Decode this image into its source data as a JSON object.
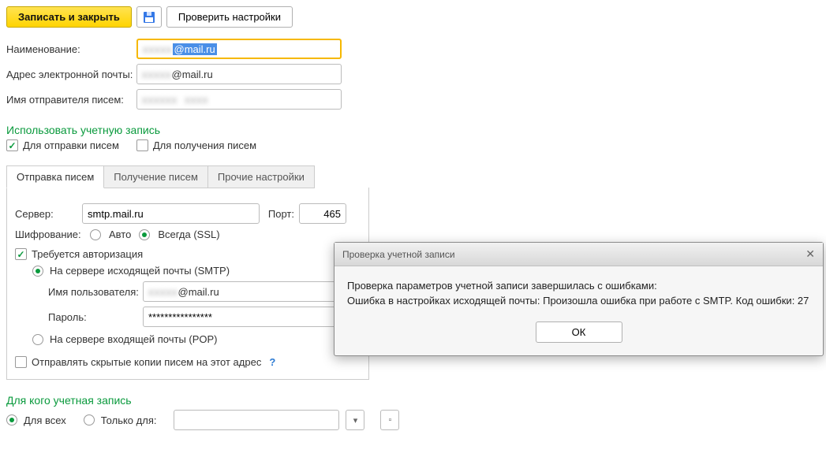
{
  "toolbar": {
    "save_label": "Записать и закрыть",
    "check_label": "Проверить настройки"
  },
  "fields": {
    "name_label": "Наименование:",
    "name_value": "@mail.ru",
    "email_label": "Адрес электронной почты:",
    "email_value": "@mail.ru",
    "sender_label": "Имя отправителя писем:",
    "sender_value": ""
  },
  "use_account": {
    "title": "Использовать учетную запись",
    "for_sending": "Для отправки писем",
    "for_sending_checked": true,
    "for_receiving": "Для получения писем",
    "for_receiving_checked": false
  },
  "tabs": {
    "send": "Отправка писем",
    "recv": "Получение писем",
    "other": "Прочие настройки"
  },
  "send": {
    "server_label": "Сервер:",
    "server_value": "smtp.mail.ru",
    "port_label": "Порт:",
    "port_value": "465",
    "enc_label": "Шифрование:",
    "enc_auto": "Авто",
    "enc_ssl": "Всегда (SSL)",
    "auth_required": "Требуется авторизация",
    "auth_smtp": "На сервере исходящей почты (SMTP)",
    "login_label": "Имя пользователя:",
    "login_value": "@mail.ru",
    "pass_label": "Пароль:",
    "pass_value": "****************",
    "auth_pop": "На сервере входящей почты (POP)",
    "bcc_self": "Отправлять скрытые копии писем на этот адрес",
    "help": "?"
  },
  "for_whom": {
    "title": "Для кого учетная запись",
    "all": "Для всех",
    "only": "Только для:"
  },
  "dialog": {
    "title": "Проверка учетной записи",
    "line1": "Проверка параметров учетной записи завершилась с ошибками:",
    "line2": "Ошибка в настройках исходящей почты: Произошла ошибка при работе с SMTP. Код ошибки: 27",
    "ok": "ОК"
  }
}
